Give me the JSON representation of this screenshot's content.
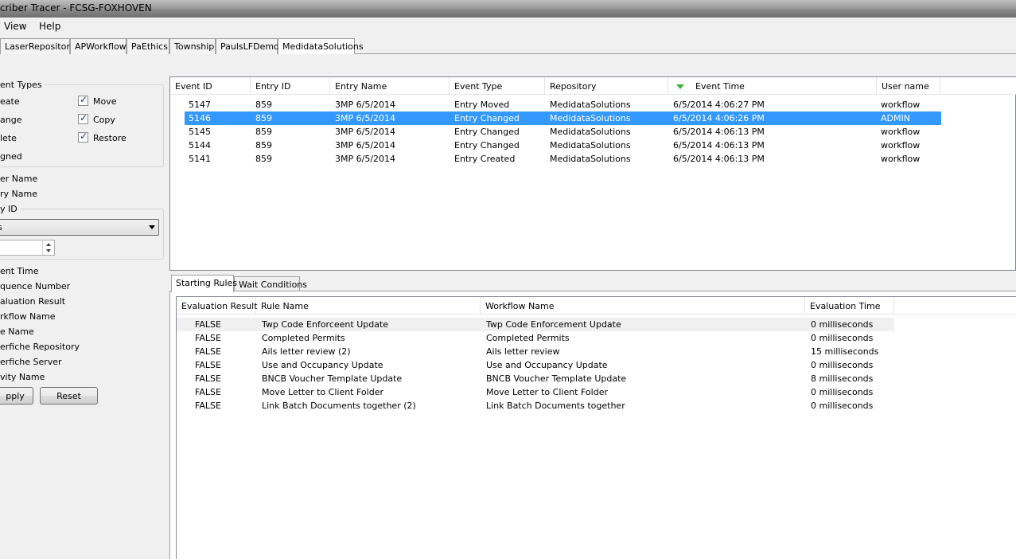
{
  "window": {
    "title": "criber Tracer - FCSG-FOXHOVEN"
  },
  "menu": {
    "view": "View",
    "help": "Help"
  },
  "repo_tabs": [
    "LaserRepository",
    "APWorkflow",
    "PaEthics",
    "Township",
    "PaulsLFDemo",
    "MedidataSolutions"
  ],
  "filters": {
    "event_types_label": "ent Types",
    "create_label": "eate",
    "change_label": "ange",
    "delete_label": "lete",
    "signed_label": "gned",
    "move_label": "Move",
    "copy_label": "Copy",
    "restore_label": "Restore",
    "user_name_label": "er Name",
    "entry_name_label": "ry Name",
    "entry_id_label": "y ID",
    "entry_id_select_value": "s",
    "event_time_label": "ent Time",
    "sequence_number_label": "quence Number",
    "evaluation_result_label": "aluation Result",
    "workflow_name_label": "rkflow Name",
    "rule_name_label": "e Name",
    "laserfiche_repository_label": "erfiche Repository",
    "laserfiche_server_label": "erfiche Server",
    "activity_name_label": "vity Name",
    "apply_label": "pply",
    "reset_label": "Reset"
  },
  "events": {
    "columns": [
      "Event ID",
      "Entry ID",
      "Entry Name",
      "Event Type",
      "Repository",
      "Event Time",
      "User name"
    ],
    "rows": [
      [
        "5147",
        "859",
        "3MP 6/5/2014",
        "Entry Moved",
        "MedidataSolutions",
        "6/5/2014 4:06:27 PM",
        "workflow"
      ],
      [
        "5146",
        "859",
        "3MP 6/5/2014",
        "Entry Changed",
        "MedidataSolutions",
        "6/5/2014 4:06:26 PM",
        "ADMIN"
      ],
      [
        "5145",
        "859",
        "3MP 6/5/2014",
        "Entry Changed",
        "MedidataSolutions",
        "6/5/2014 4:06:13 PM",
        "workflow"
      ],
      [
        "5144",
        "859",
        "3MP 6/5/2014",
        "Entry Changed",
        "MedidataSolutions",
        "6/5/2014 4:06:13 PM",
        "workflow"
      ],
      [
        "5141",
        "859",
        "3MP 6/5/2014",
        "Entry Created",
        "MedidataSolutions",
        "6/5/2014 4:06:13 PM",
        "workflow"
      ]
    ],
    "selected_row": 1
  },
  "lower_tabs": {
    "starting_rules": "Starting Rules",
    "wait_conditions": "Wait Conditions"
  },
  "rules": {
    "columns": [
      "Evaluation Result",
      "Rule Name",
      "Workflow Name",
      "Evaluation Time"
    ],
    "rows": [
      [
        "FALSE",
        "Twp Code Enforceent Update",
        "Twp Code Enforcement Update",
        "0 milliseconds"
      ],
      [
        "FALSE",
        "Completed Permits",
        "Completed Permits",
        "0 milliseconds"
      ],
      [
        "FALSE",
        "Ails letter review (2)",
        "Ails letter review",
        "15 milliseconds"
      ],
      [
        "FALSE",
        "Use and Occupancy Update",
        "Use and Occupancy Update",
        "0 milliseconds"
      ],
      [
        "FALSE",
        "BNCB Voucher Template Update",
        "BNCB Voucher Template Update",
        "8 milliseconds"
      ],
      [
        "FALSE",
        "Move Letter to Client Folder",
        "Move Letter to Client Folder",
        "0 milliseconds"
      ],
      [
        "FALSE",
        "Link Batch Documents together (2)",
        "Link Batch Documents together",
        "0 milliseconds"
      ]
    ]
  }
}
